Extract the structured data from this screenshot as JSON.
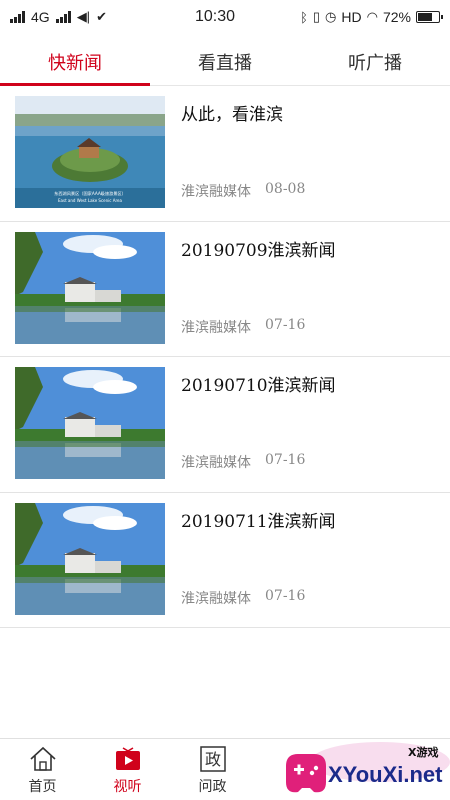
{
  "status_bar": {
    "network": "4G",
    "time": "10:30",
    "hd": "HD",
    "battery_text": "72%",
    "battery_level": 0.72
  },
  "tabs": [
    {
      "label": "快新闻",
      "active": true
    },
    {
      "label": "看直播",
      "active": false
    },
    {
      "label": "听广播",
      "active": false
    }
  ],
  "news": [
    {
      "title": "从此，看淮滨",
      "source": "淮滨融媒体",
      "date": "08-08",
      "thumb_caption": "东西湖风景区（国家AAA级旅游景区）",
      "thumb_caption_en": "East and West Lake Scenic Area"
    },
    {
      "title": "20190709淮滨新闻",
      "source": "淮滨融媒体",
      "date": "07-16"
    },
    {
      "title": "20190710淮滨新闻",
      "source": "淮滨融媒体",
      "date": "07-16"
    },
    {
      "title": "20190711淮滨新闻",
      "source": "淮滨融媒体",
      "date": "07-16"
    }
  ],
  "bottom_nav": [
    {
      "label": "首页",
      "icon": "home-icon",
      "active": false
    },
    {
      "label": "视听",
      "icon": "video-icon",
      "active": true
    },
    {
      "label": "问政",
      "icon": "zheng-icon",
      "active": false,
      "icon_char": "政"
    }
  ],
  "watermark": {
    "text": "XYouXi.net",
    "sub": "X游戏"
  },
  "colors": {
    "accent": "#d0021b",
    "divider": "#e3e3e3",
    "meta": "#888888"
  }
}
